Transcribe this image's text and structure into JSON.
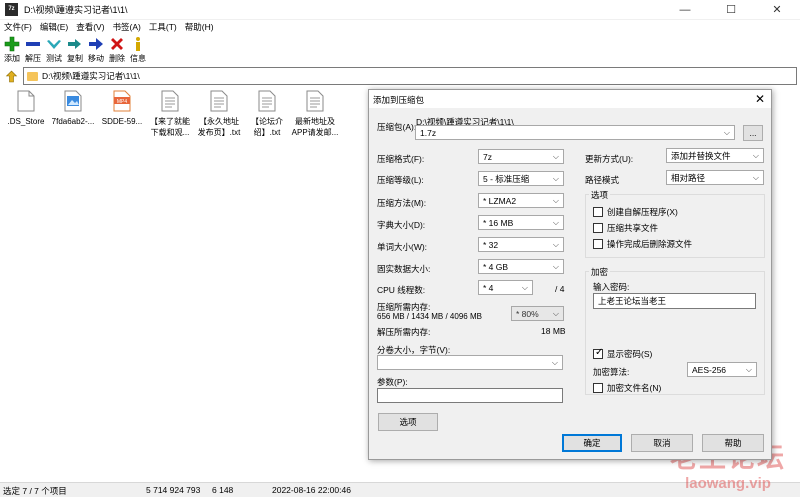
{
  "window": {
    "title": "D:\\视频\\踵遵实习记者\\1\\1\\",
    "app_icon_text": "7z",
    "controls": {
      "minimize": "—",
      "maximize": "☐",
      "close": "✕"
    }
  },
  "menu": [
    "文件(F)",
    "编辑(E)",
    "查看(V)",
    "书签(A)",
    "工具(T)",
    "帮助(H)"
  ],
  "toolbar": [
    {
      "label": "添加",
      "icon": "plus-icon",
      "color": "#1a9c1a"
    },
    {
      "label": "解压",
      "icon": "minus-icon",
      "color": "#1f3fb5"
    },
    {
      "label": "测试",
      "icon": "check-icon",
      "color": "#2aa8b8"
    },
    {
      "label": "复制",
      "icon": "double-arrow-icon",
      "color": "#1b8a8a"
    },
    {
      "label": "移动",
      "icon": "arrow-right-icon",
      "color": "#1f3fb5"
    },
    {
      "label": "删除",
      "icon": "cross-icon",
      "color": "#d01515"
    },
    {
      "label": "信息",
      "icon": "info-icon",
      "color": "#d4a800"
    }
  ],
  "address": {
    "path": "D:\\视频\\踵遵实习记者\\1\\1\\"
  },
  "files": [
    {
      "line1": ".DS_Store",
      "line2": "",
      "type": "blank"
    },
    {
      "line1": "7fda6ab2-...",
      "line2": "",
      "type": "image"
    },
    {
      "line1": "SDDE-59...",
      "line2": "",
      "type": "mp4",
      "badge": "MP4"
    },
    {
      "line1": "【来了就能",
      "line2": "下载和观...",
      "type": "text"
    },
    {
      "line1": "【永久地址",
      "line2": "发布页】.txt",
      "type": "text"
    },
    {
      "line1": "【论坛介",
      "line2": "绍】.txt",
      "type": "text"
    },
    {
      "line1": "最新地址及",
      "line2": "APP请发邮...",
      "type": "text"
    }
  ],
  "status": {
    "selected": "选定 7 / 7 个项目",
    "size": "5 714 924 793",
    "packed": "6 148",
    "date": "2022-08-16 22:00:46"
  },
  "watermark": {
    "main": "老王论坛",
    "sub": "laowang.vip"
  },
  "dialog": {
    "title": "添加到压缩包",
    "close": "✕",
    "archive_label": "压缩包(A):",
    "archive_path": "D:\\视频\\踵遵实习记者\\1\\1\\",
    "archive_name": "1.7z",
    "browse": "...",
    "format_label": "压缩格式(F):",
    "format_value": "7z",
    "level_label": "压缩等级(L):",
    "level_value": "5 - 标准压缩",
    "method_label": "压缩方法(M):",
    "method_value": "* LZMA2",
    "dict_label": "字典大小(D):",
    "dict_value": "* 16 MB",
    "word_label": "单词大小(W):",
    "word_value": "* 32",
    "solid_label": "固实数据大小:",
    "solid_value": "* 4 GB",
    "cpu_label": "CPU 线程数:",
    "cpu_value": "* 4",
    "cpu_max": "/ 4",
    "mem_comp_label": "压缩所需内存:",
    "mem_comp_detail": "656 MB / 1434 MB / 4096 MB",
    "mem_comp_pct": "* 80%",
    "mem_decomp_label": "解压所需内存:",
    "mem_decomp_value": "18 MB",
    "split_label": "分卷大小，字节(V):",
    "split_value": "",
    "params_label": "参数(P):",
    "params_value": "",
    "options_button": "选项",
    "update_label": "更新方式(U):",
    "update_value": "添加并替换文件",
    "pathmode_label": "路径模式",
    "pathmode_value": "相对路径",
    "options_group": "选项",
    "opt_sfx": "创建自解压程序(X)",
    "opt_shared": "压缩共享文件",
    "opt_delete": "操作完成后删除源文件",
    "encrypt_group": "加密",
    "password_label": "输入密码:",
    "password_value": "上老王论坛当老王",
    "show_password": "显示密码(S)",
    "enc_method_label": "加密算法:",
    "enc_method_value": "AES-256",
    "enc_names": "加密文件名(N)",
    "ok": "确定",
    "cancel": "取消",
    "help": "帮助"
  }
}
